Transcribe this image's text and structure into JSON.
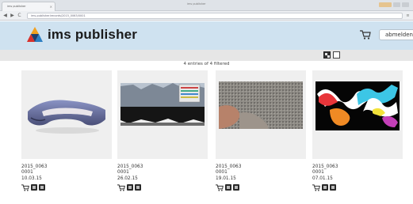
{
  "browser": {
    "tab_title": "ims publisher",
    "tab_close": "×",
    "window_title": "ims publisher",
    "url": "ims-publisher/records/2015_0063/0001",
    "back": "◀",
    "forward": "▶",
    "reload": "C",
    "menu": "≡"
  },
  "header": {
    "brand": "ims publisher",
    "user": "abmelden",
    "logo_colors": [
      "#f2a11f",
      "#d8312b",
      "#2c7fc2"
    ],
    "background": "#cfe2f0"
  },
  "toolbar": {
    "filter_info": "4 entries of 4 filtered"
  },
  "items": [
    {
      "id": "2015_0063",
      "sub": "0001",
      "date": "10.03.15",
      "image": "ceramic-sherd-photo"
    },
    {
      "id": "2015_0063",
      "sub": "0001",
      "date": "26.02.15",
      "image": "soil-profile-photo"
    },
    {
      "id": "2015_0063",
      "sub": "0001",
      "date": "19.01.15",
      "image": "stone-surface-photo"
    },
    {
      "id": "2015_0063",
      "sub": "0001",
      "date": "07.01.15",
      "image": "false-color-map"
    }
  ]
}
